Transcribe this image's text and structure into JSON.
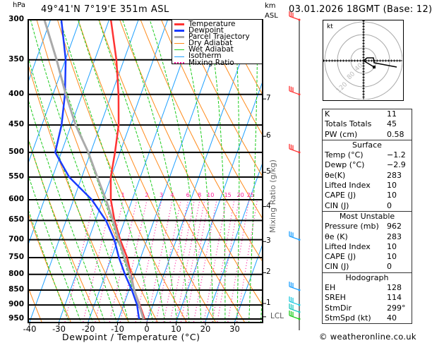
{
  "header": {
    "location": "49°41'N  7°19'E  351m  ASL",
    "datetime": "03.01.2026  18GMT  (Base: 12)",
    "pressure_unit": "hPa",
    "height_unit_line1": "km",
    "height_unit_line2": "ASL"
  },
  "colors": {
    "temperature": "#ff3333",
    "dewpoint": "#1a3cff",
    "parcel": "#aaaaaa",
    "dry_adiabat": "#ff8a1a",
    "wet_adiabat": "#1ecc1e",
    "isotherm": "#1ea0ff",
    "mixing_ratio": "#ff1a9c"
  },
  "legend": [
    {
      "label": "Temperature",
      "key": "temperature"
    },
    {
      "label": "Dewpoint",
      "key": "dewpoint"
    },
    {
      "label": "Parcel Trajectory",
      "key": "parcel"
    },
    {
      "label": "Dry Adiabat",
      "key": "dry_adiabat"
    },
    {
      "label": "Wet Adiabat",
      "key": "wet_adiabat"
    },
    {
      "label": "Isotherm",
      "key": "isotherm"
    },
    {
      "label": "Mixing Ratio",
      "key": "mixing_ratio"
    }
  ],
  "chart_data": {
    "type": "line",
    "subtype": "skew-T log-p",
    "xlabel": "Dewpoint / Temperature (°C)",
    "ylabel": "hPa",
    "xlim": [
      -40,
      40
    ],
    "ylim": [
      960,
      300
    ],
    "y_scale": "log",
    "x_ticks": [
      -40,
      -30,
      -20,
      -10,
      0,
      10,
      20,
      30
    ],
    "pressure_levels": [
      300,
      350,
      400,
      450,
      500,
      550,
      600,
      650,
      700,
      750,
      800,
      850,
      900,
      950
    ],
    "km_labels": [
      {
        "km": "7",
        "p": 407
      },
      {
        "km": "6",
        "p": 470
      },
      {
        "km": "5",
        "p": 540
      },
      {
        "km": "4",
        "p": 616
      },
      {
        "km": "3",
        "p": 705
      },
      {
        "km": "2",
        "p": 795
      },
      {
        "km": "1",
        "p": 895
      },
      {
        "km": "LCL",
        "p": 942
      }
    ],
    "mixing_ratio_axis_label": "Mixing Ratio (g/kg)",
    "mixing_ratio_labels": [
      1,
      2,
      3,
      4,
      6,
      8,
      10,
      15,
      20,
      25
    ],
    "series": [
      {
        "name": "Temperature",
        "p": [
          950,
          900,
          850,
          800,
          750,
          700,
          650,
          600,
          550,
          500,
          450,
          400,
          350,
          300
        ],
        "t": [
          -1.1,
          -4.5,
          -8.2,
          -11.3,
          -14.6,
          -19.2,
          -23.5,
          -27.3,
          -30.1,
          -31.7,
          -33.8,
          -37.6,
          -42.6,
          -49.4
        ]
      },
      {
        "name": "Dewpoint",
        "p": [
          950,
          900,
          850,
          800,
          750,
          700,
          650,
          600,
          550,
          500,
          450,
          400,
          350,
          300
        ],
        "t": [
          -3.0,
          -5.4,
          -9.0,
          -13.3,
          -17.4,
          -21.2,
          -26.4,
          -33.8,
          -44.3,
          -52.1,
          -53.3,
          -55.9,
          -59.9,
          -66.3
        ]
      },
      {
        "name": "Parcel Trajectory",
        "p": [
          950,
          900,
          850,
          800,
          750,
          700,
          650,
          600,
          550,
          500,
          450,
          400,
          350,
          300
        ],
        "t": [
          -1.5,
          -4.7,
          -8.2,
          -11.6,
          -15.5,
          -19.7,
          -24.0,
          -29.0,
          -34.7,
          -40.8,
          -48.5,
          -55.6,
          -63.0,
          -72.1
        ]
      }
    ],
    "wind_barbs": [
      {
        "p": 300,
        "color": "#ff3333"
      },
      {
        "p": 400,
        "color": "#ff3333"
      },
      {
        "p": 500,
        "color": "#ff3333"
      },
      {
        "p": 700,
        "color": "#1ea0ff"
      },
      {
        "p": 850,
        "color": "#1ea0ff"
      },
      {
        "p": 900,
        "color": "#1ec8e0"
      },
      {
        "p": 925,
        "color": "#1ec8c0"
      },
      {
        "p": 950,
        "color": "#1ecc1e"
      }
    ]
  },
  "hodograph": {
    "unit": "kt",
    "ring_labels": [
      "40",
      "80",
      "120"
    ]
  },
  "indices": {
    "general": [
      {
        "label": "K",
        "value": "11"
      },
      {
        "label": "Totals Totals",
        "value": "45"
      },
      {
        "label": "PW (cm)",
        "value": "0.58"
      }
    ],
    "surface": {
      "title": "Surface",
      "rows": [
        {
          "label": "Temp (°C)",
          "value": "−1.2"
        },
        {
          "label": "Dewp (°C)",
          "value": "−2.9"
        },
        {
          "label": "θe(K)",
          "value": "283"
        },
        {
          "label": "Lifted Index",
          "value": "10"
        },
        {
          "label": "CAPE (J)",
          "value": "10"
        },
        {
          "label": "CIN (J)",
          "value": "0"
        }
      ]
    },
    "most_unstable": {
      "title": "Most Unstable",
      "rows": [
        {
          "label": "Pressure (mb)",
          "value": "962"
        },
        {
          "label": "θe (K)",
          "value": "283"
        },
        {
          "label": "Lifted Index",
          "value": "10"
        },
        {
          "label": "CAPE (J)",
          "value": "10"
        },
        {
          "label": "CIN (J)",
          "value": "0"
        }
      ]
    },
    "hodograph": {
      "title": "Hodograph",
      "rows": [
        {
          "label": "EH",
          "value": "128"
        },
        {
          "label": "SREH",
          "value": "114"
        },
        {
          "label": "StmDir",
          "value": "299°"
        },
        {
          "label": "StmSpd (kt)",
          "value": "40"
        }
      ]
    }
  },
  "footer": {
    "copyright": "© weatheronline.co.uk"
  }
}
